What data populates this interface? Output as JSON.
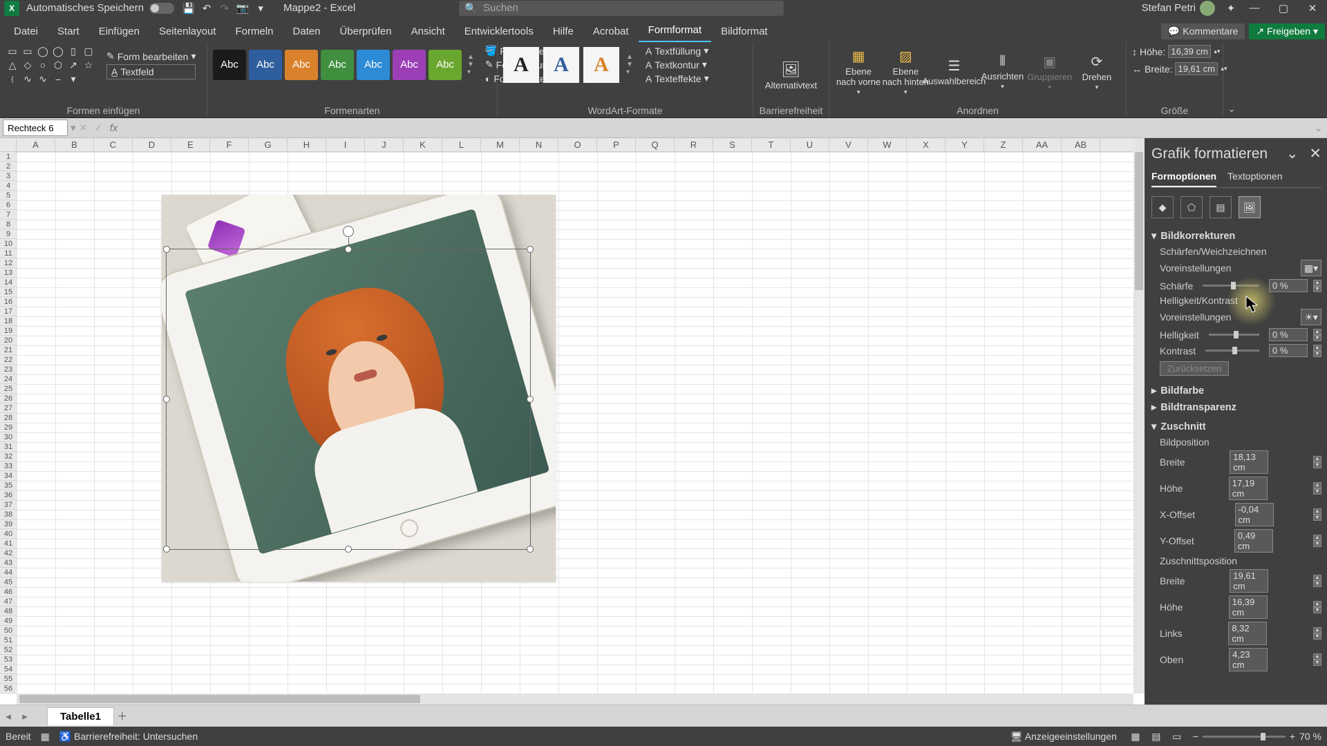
{
  "titlebar": {
    "autosave_label": "Automatisches Speichern",
    "doc_name": "Mappe2 - Excel",
    "search_placeholder": "Suchen",
    "user_name": "Stefan Petri"
  },
  "tabs": [
    "Datei",
    "Start",
    "Einfügen",
    "Seitenlayout",
    "Formeln",
    "Daten",
    "Überprüfen",
    "Ansicht",
    "Entwicklertools",
    "Hilfe",
    "Acrobat",
    "Formformat",
    "Bildformat"
  ],
  "active_tab_index": 11,
  "tab_buttons": {
    "comments": "Kommentare",
    "share": "Freigeben"
  },
  "ribbon": {
    "shapes_group": "Formen einfügen",
    "edit_shape": "Form bearbeiten",
    "text_box": "Textfeld",
    "styles_group": "Formenarten",
    "fill": "Fülleffekte",
    "outline": "Formkontur",
    "effects": "Formeffekte",
    "style_colors": [
      "#1b1b1b",
      "#2f5e9e",
      "#d9822b",
      "#3f8f3f",
      "#2d8bd6",
      "#9c3fb7",
      "#6aa72e"
    ],
    "wordart_group": "WordArt-Formate",
    "text_fill": "Textfüllung",
    "text_outline": "Textkontur",
    "text_effects": "Texteffekte",
    "alt_text": "Alternativtext",
    "access_group": "Barrierefreiheit",
    "bring_forward": "Ebene nach vorne",
    "send_backward": "Ebene nach hinten",
    "selection_pane": "Auswahlbereich",
    "align": "Ausrichten",
    "group": "Gruppieren",
    "rotate": "Drehen",
    "arrange_group": "Anordnen",
    "height_label": "Höhe:",
    "width_label": "Breite:",
    "height_value": "16,39 cm",
    "width_value": "19,61 cm",
    "size_group": "Größe"
  },
  "namebox": "Rechteck 6",
  "columns": [
    "A",
    "B",
    "C",
    "D",
    "E",
    "F",
    "G",
    "H",
    "I",
    "J",
    "K",
    "L",
    "M",
    "N",
    "O",
    "P",
    "Q",
    "R",
    "S",
    "T",
    "U",
    "V",
    "W",
    "X",
    "Y",
    "Z",
    "AA",
    "AB"
  ],
  "row_count": 56,
  "pane": {
    "title": "Grafik formatieren",
    "tab_shape": "Formoptionen",
    "tab_text": "Textoptionen",
    "sec_corrections": "Bildkorrekturen",
    "sharpen_soft": "Schärfen/Weichzeichnen",
    "presets": "Voreinstellungen",
    "sharpness": "Schärfe",
    "sharp_val": "0 %",
    "bright_contrast": "Helligkeit/Kontrast",
    "brightness": "Helligkeit",
    "bright_val": "0 %",
    "contrast": "Kontrast",
    "contrast_val": "0 %",
    "reset": "Zurücksetzen",
    "sec_color": "Bildfarbe",
    "sec_trans": "Bildtransparenz",
    "sec_crop": "Zuschnitt",
    "pic_position": "Bildposition",
    "width": "Breite",
    "width_v": "18,13 cm",
    "height": "Höhe",
    "height_v": "17,19 cm",
    "xoff": "X-Offset",
    "xoff_v": "-0,04 cm",
    "yoff": "Y-Offset",
    "yoff_v": "0,49 cm",
    "crop_position": "Zuschnittsposition",
    "c_width": "Breite",
    "c_width_v": "19,61 cm",
    "c_height": "Höhe",
    "c_height_v": "16,39 cm",
    "c_left": "Links",
    "c_left_v": "8,32 cm",
    "c_top": "Oben",
    "c_top_v": "4,23 cm"
  },
  "sheet_tab": "Tabelle1",
  "status": {
    "ready": "Bereit",
    "access": "Barrierefreiheit: Untersuchen",
    "display": "Anzeigeeinstellungen",
    "zoom": "70 %"
  }
}
